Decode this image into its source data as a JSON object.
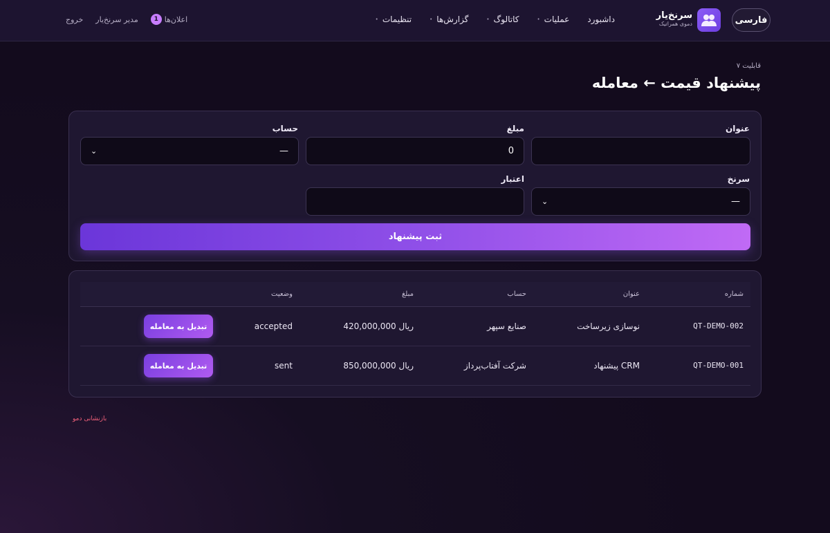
{
  "header": {
    "lang_label": "فارسی",
    "brand_title": "سرنخ‌یار",
    "brand_subtitle": "دموی همراتیک",
    "nav": [
      {
        "label": "داشبورد",
        "has_menu": false
      },
      {
        "label": "عملیات",
        "has_menu": true
      },
      {
        "label": "کاتالوگ",
        "has_menu": true
      },
      {
        "label": "گزارش‌ها",
        "has_menu": true
      },
      {
        "label": "تنظیمات",
        "has_menu": true
      }
    ],
    "notifications_label": "اعلان‌ها",
    "notifications_count": "1",
    "user_label": "مدیر سرنخ‌یار",
    "logout_label": "خروج"
  },
  "page": {
    "breadcrumb": "قابلیت ۷",
    "title": "پیشنهاد قیمت ← معامله"
  },
  "form": {
    "title_label": "عنوان",
    "title_value": "",
    "amount_label": "مبلغ",
    "amount_value": "0",
    "account_label": "حساب",
    "account_value": "—",
    "lead_label": "سرنخ",
    "lead_value": "—",
    "validity_label": "اعتبار",
    "validity_value": "",
    "submit_label": "ثبت پیشنهاد"
  },
  "table": {
    "columns": {
      "number": "شماره",
      "title": "عنوان",
      "account": "حساب",
      "amount": "مبلغ",
      "status": "وضعیت"
    },
    "rows": [
      {
        "number": "QT-DEMO-002",
        "title": "نوسازی زیرساخت",
        "account": "صنایع سپهر",
        "amount": "420,000,000 ریال",
        "status": "accepted",
        "action": "تبدیل به معامله"
      },
      {
        "number": "QT-DEMO-001",
        "title": "پیشنهاد CRM",
        "account": "شرکت آفتاب‌پرداز",
        "amount": "850,000,000 ریال",
        "status": "sent",
        "action": "تبدیل به معامله"
      }
    ]
  },
  "footer": {
    "reset_label": "بازنشانی دمو"
  },
  "colors": {
    "accent": "#8b5cf6",
    "background": "#140c1f",
    "danger": "#f2617a"
  }
}
